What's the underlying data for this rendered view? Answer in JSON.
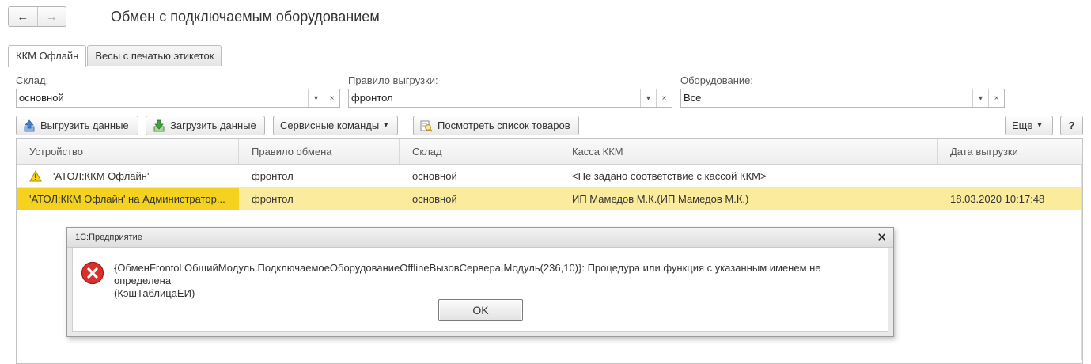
{
  "header": {
    "back": "←",
    "forward": "→",
    "title": "Обмен с подключаемым оборудованием"
  },
  "tabs": [
    {
      "label": "ККМ Офлайн",
      "active": true
    },
    {
      "label": "Весы с печатью этикеток",
      "active": false
    }
  ],
  "filters": {
    "warehouse": {
      "label": "Склад:",
      "value": "основной"
    },
    "rule": {
      "label": "Правило выгрузки:",
      "value": "фронтол"
    },
    "equipment": {
      "label": "Оборудование:",
      "value": "Все"
    },
    "dropdown_glyph": "▾",
    "clear_glyph": "×"
  },
  "toolbar": {
    "upload": "Выгрузить данные",
    "download": "Загрузить данные",
    "service": "Сервисные команды",
    "service_arrow": "▾",
    "view_goods": "Посмотреть список товаров",
    "more": "Еще",
    "more_arrow": "▾",
    "help": "?"
  },
  "table": {
    "columns": [
      "Устройство",
      "Правило обмена",
      "Склад",
      "Касса ККМ",
      "Дата выгрузки"
    ],
    "rows": [
      {
        "device": "'АТОЛ:ККМ Офлайн'",
        "rule": "фронтол",
        "warehouse": "основной",
        "register": "<Не задано соответствие с кассой ККМ>",
        "date": "",
        "warning": true
      },
      {
        "device": "'АТОЛ:ККМ Офлайн' на Администратор...",
        "rule": "фронтол",
        "warehouse": "основной",
        "register": "ИП Мамедов М.К.(ИП Мамедов М.К.)",
        "date": "18.03.2020 10:17:48",
        "selected": true
      }
    ]
  },
  "dialog": {
    "title": "1С:Предприятие",
    "close": "✕",
    "message_line1": "{ОбменFrontol ОбщийМодуль.ПодключаемоеОборудованиеOfflineВызовСервера.Модуль(236,10)}: Процедура или функция с указанным именем не определена",
    "message_line2": "(КэшТаблицаЕИ)",
    "ok": "OK"
  },
  "colors": {
    "selected_row": "#fbeb9c",
    "selected_cell": "#f5d21f",
    "warning_text": "#d10000",
    "error_icon": "#d9302b"
  }
}
